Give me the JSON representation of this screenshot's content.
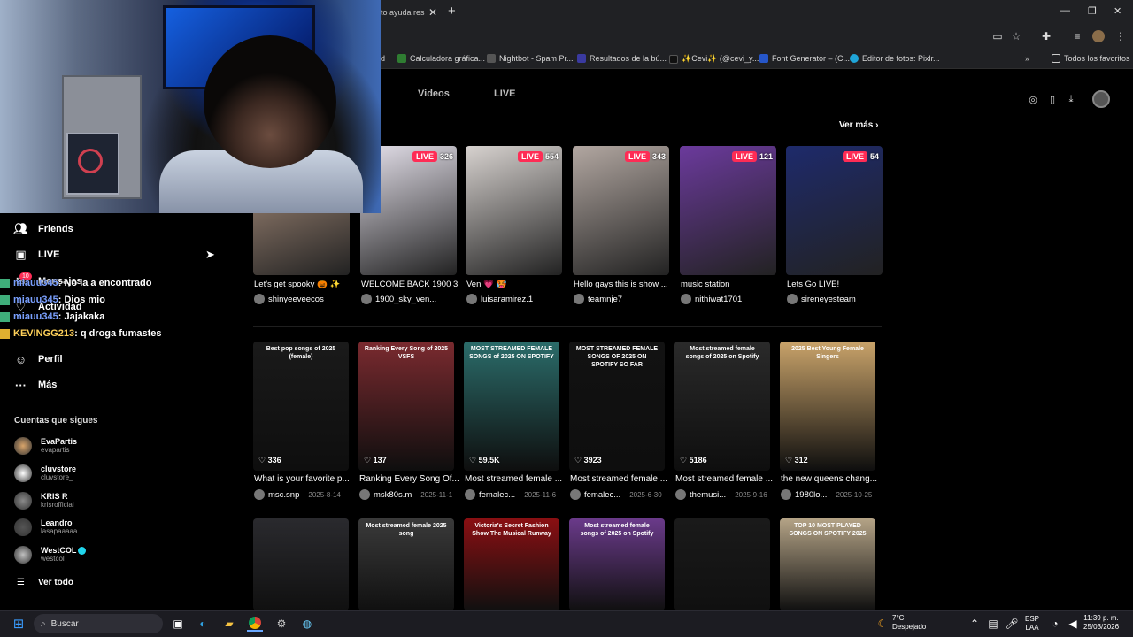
{
  "browser": {
    "tab_title": "to ayuda res",
    "bookmarks": [
      {
        "label": "d",
        "color": "#888888"
      },
      {
        "label": "Calculadora gráfica...",
        "color": "#2f7d32"
      },
      {
        "label": "Nightbot - Spam Pr...",
        "color": "#555555"
      },
      {
        "label": "Resultados de la bú...",
        "color": "#3a3aa0"
      },
      {
        "label": "✨Cevi✨ (@cevi_y...",
        "color": "#111111"
      },
      {
        "label": "Font Generator – (C...",
        "color": "#2656c9"
      },
      {
        "label": "Editor de fotos: Pixlr...",
        "color": "#1fa5d8"
      }
    ],
    "bookmarks_other": "Todos los favoritos"
  },
  "sidebar": {
    "nav": [
      {
        "label": "Friends",
        "icon": "friends-icon"
      },
      {
        "label": "LIVE",
        "icon": "live-icon"
      },
      {
        "label": "Mensajes",
        "icon": "message-icon"
      },
      {
        "label": "Actividad",
        "icon": "activity-icon"
      },
      {
        "label": "Perfil",
        "icon": "profile-icon"
      },
      {
        "label": "Más",
        "icon": "more-icon"
      }
    ],
    "messages_badge": "10",
    "following_title": "Cuentas que sigues",
    "following": [
      {
        "name": "EvaPartis",
        "handle": "evapartis",
        "color": "#d9a56b"
      },
      {
        "name": "cluvstore",
        "handle": "cluvstore_",
        "color": "#ffffff"
      },
      {
        "name": "KRIS R",
        "handle": "krisrofficial",
        "color": "#8a8a8a"
      },
      {
        "name": "Leandro",
        "handle": "lasapaaaaa",
        "color": "#555555"
      },
      {
        "name": "WestCOL",
        "handle": "westcol",
        "color": "#c0c0c0"
      }
    ],
    "see_all": "Ver todo"
  },
  "chat": [
    {
      "user": "miauu345",
      "text": ": No la a encontrado"
    },
    {
      "user": "miauu345",
      "text": ": Dios mio"
    },
    {
      "user": "miauu345",
      "text": ": Jajakaka"
    },
    {
      "user": "KEVINGG213",
      "text": ": q droga fumastes"
    }
  ],
  "main": {
    "tabs": [
      "Videos",
      "LIVE"
    ],
    "see_more": "Ver más",
    "live": [
      {
        "count": "",
        "title": "Let's get spooky 🎃 ✨",
        "author": "shinyeeveecos",
        "bg": "#b89a86"
      },
      {
        "count": "326",
        "title": "WELCOME BACK 1900 3",
        "author": "1900_sky_ven...",
        "bg": "#e4e0ea"
      },
      {
        "count": "554",
        "title": "Ven 💗 🥵",
        "author": "luisaramirez.1",
        "bg": "#d7d2cf"
      },
      {
        "count": "343",
        "title": "Hello gays this is show ...",
        "author": "teamnje7",
        "bg": "#b2a7a1"
      },
      {
        "count": "121",
        "title": "music station",
        "author": "nithiwat1701",
        "bg": "#6b3a9c"
      },
      {
        "count": "54",
        "title": "Lets Go LIVE!",
        "author": "sireneyesteam",
        "bg": "#1e2a6b"
      }
    ],
    "videos": [
      {
        "overlay": "Best pop songs of 2025 (female)",
        "likes": "336",
        "title": "What is your favorite p...",
        "author": "msc.snp",
        "date": "2025-8-14",
        "bg": "#1a1a1a"
      },
      {
        "overlay": "Ranking Every Song of 2025 VSFS",
        "likes": "137",
        "title": "Ranking Every Song Of...",
        "author": "msk80s.m",
        "date": "2025-11-1",
        "bg": "#7a2a2f"
      },
      {
        "overlay": "MOST STREAMED FEMALE SONGS of 2025 ON SPOTIFY",
        "likes": "59.5K",
        "title": "Most streamed female ...",
        "author": "femalec...",
        "date": "2025-11-6",
        "bg": "#2b6c6a"
      },
      {
        "overlay": "MOST STREAMED FEMALE SONGS OF 2025 ON SPOTIFY SO FAR",
        "likes": "3923",
        "title": "Most streamed female ...",
        "author": "femalec...",
        "date": "2025-6-30",
        "bg": "#121212"
      },
      {
        "overlay": "Most streamed female songs of 2025 on Spotify",
        "likes": "5186",
        "title": "Most streamed female ...",
        "author": "themusi...",
        "date": "2025-9-16",
        "bg": "#2a2a2a"
      },
      {
        "overlay": "2025 Best Young Female Singers",
        "likes": "312",
        "title": "the new queens chang...",
        "author": "1980lo...",
        "date": "2025-10-25",
        "bg": "#c9a36a"
      }
    ],
    "row3": [
      {
        "overlay": "",
        "bg": "#2a2a2e"
      },
      {
        "overlay": "Most streamed female 2025 song",
        "bg": "#3a3a3a"
      },
      {
        "overlay": "Victoria's Secret Fashion Show The Musical Runway",
        "bg": "#8a0f12"
      },
      {
        "overlay": "Most streamed female songs of 2025 on Spotify",
        "bg": "#6a3a8a"
      },
      {
        "overlay": "",
        "bg": "#1a1a1a"
      },
      {
        "overlay": "TOP 10 MOST PLAYED SONGS ON SPOTIFY 2025",
        "bg": "#b4a386"
      }
    ]
  },
  "taskbar": {
    "search": "Buscar",
    "weather_temp": "7°C",
    "weather_desc": "Despejado",
    "lang_top": "ESP",
    "lang_bottom": "LAA",
    "time": "11:39 p. m.",
    "date": "25/03/2026"
  }
}
